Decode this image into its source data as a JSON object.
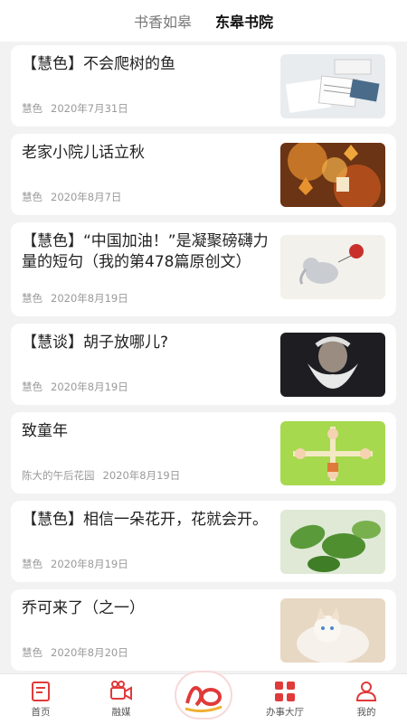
{
  "header": {
    "tabs": [
      {
        "label": "书香如皋",
        "active": false
      },
      {
        "label": "东皋书院",
        "active": true
      }
    ]
  },
  "articles": [
    {
      "title": "【慧色】不会爬树的鱼",
      "author": "慧色",
      "date": "2020年7月31日",
      "thumb": "book-notes-icon"
    },
    {
      "title": "老家小院儿话立秋",
      "author": "慧色",
      "date": "2020年8月7日",
      "thumb": "autumn-leaves-icon"
    },
    {
      "title": "【慧色】“中国加油！”是凝聚磅礴力量的短句（我的第478篇原创文）",
      "author": "慧色",
      "date": "2020年8月19日",
      "thumb": "elephant-balloon-icon"
    },
    {
      "title": "【慧谈】胡子放哪儿?",
      "author": "慧色",
      "date": "2020年8月19日",
      "thumb": "old-man-beard-icon"
    },
    {
      "title": "致童年",
      "author": "陈大的午后花园",
      "date": "2020年8月19日",
      "thumb": "children-playing-icon"
    },
    {
      "title": "【慧色】相信一朵花开，花就会开。",
      "author": "慧色",
      "date": "2020年8月19日",
      "thumb": "green-leaves-icon"
    },
    {
      "title": "乔可来了（之一）",
      "author": "慧色",
      "date": "2020年8月20日",
      "thumb": "cat-icon"
    }
  ],
  "nav": {
    "items": [
      {
        "label": "首页",
        "icon": "home-icon"
      },
      {
        "label": "融媒",
        "icon": "video-camera-icon"
      },
      {
        "label": "办事大厅",
        "icon": "grid-apps-icon"
      },
      {
        "label": "我的",
        "icon": "user-icon"
      }
    ],
    "center_icon": "app-logo-icon",
    "accent": "#e03a3a"
  }
}
